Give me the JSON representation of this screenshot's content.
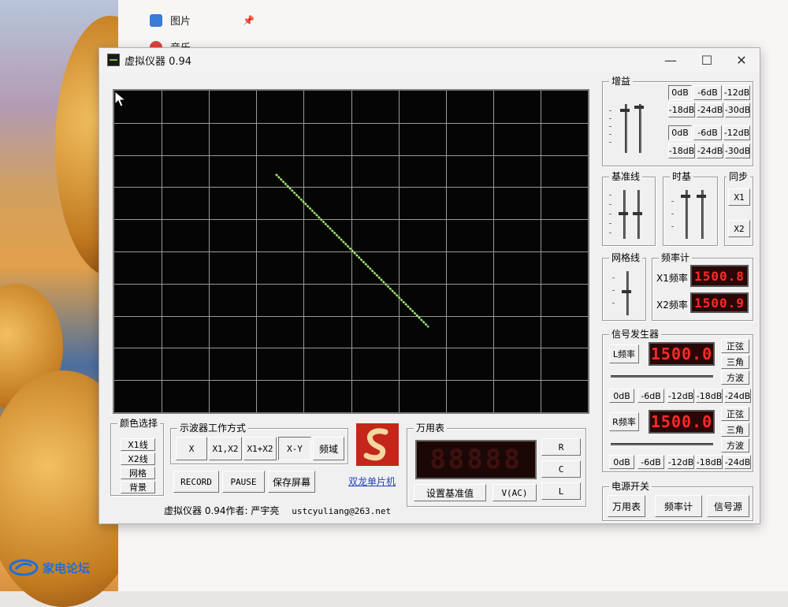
{
  "explorer": {
    "items": [
      {
        "label": "图片"
      },
      {
        "label": "音乐"
      }
    ]
  },
  "window": {
    "title": "虚拟仪器 0.94",
    "minimize": "—",
    "maximize": "☐",
    "close": "✕"
  },
  "gain": {
    "title": "增益",
    "row1": [
      "0dB",
      "-6dB",
      "-12dB"
    ],
    "row2": [
      "-18dB",
      "-24dB",
      "-30dB"
    ],
    "row3": [
      "0dB",
      "-6dB",
      "-12dB"
    ],
    "row4": [
      "-18dB",
      "-24dB",
      "-30dB"
    ]
  },
  "baseline": {
    "title": "基准线"
  },
  "timebase": {
    "title": "时基"
  },
  "sync": {
    "title": "同步",
    "x1": "X1",
    "x2": "X2"
  },
  "grid": {
    "title": "网格线"
  },
  "freqmeter": {
    "title": "频率计",
    "x1_label": "X1频率",
    "x2_label": "X2频率",
    "x1_value": "1500.8",
    "x2_value": "1500.9"
  },
  "siggen": {
    "title": "信号发生器",
    "l_label": "L频率",
    "l_value": "1500.0",
    "r_label": "R频率",
    "r_value": "1500.0",
    "waves": [
      "正弦",
      "三角",
      "方波"
    ],
    "db": [
      "0dB",
      "-6dB",
      "-12dB",
      "-18dB",
      "-24dB"
    ]
  },
  "power": {
    "title": "电源开关",
    "multimeter": "万用表",
    "freqmeter": "频率计",
    "siggen": "信号源"
  },
  "color": {
    "title": "颜色选择",
    "items": [
      "X1线",
      "X2线",
      "网格",
      "背景"
    ]
  },
  "mode": {
    "title": "示波器工作方式",
    "buttons": [
      "X",
      "X1,X2",
      "X1+X2",
      "X-Y",
      "频域"
    ],
    "record": "RECORD",
    "pause": "PAUSE",
    "save": "保存屏幕"
  },
  "brand": {
    "link": "双龙单片机"
  },
  "multimeter": {
    "title": "万用表",
    "display": "88888",
    "r": "R",
    "c": "C",
    "l": "L",
    "baseline_btn": "设置基准值",
    "vac": "V(AC)"
  },
  "status": {
    "text": "虚拟仪器 0.94作者: 严宇亮",
    "email": "ustcyuliang@263.net"
  },
  "watermark": {
    "text": "家电论坛"
  },
  "colors": {
    "trace": "#9be86a",
    "grid": "#9a9a9a",
    "led": "#ff2a2a"
  },
  "scope_trace": {
    "mode": "X-Y"
  }
}
